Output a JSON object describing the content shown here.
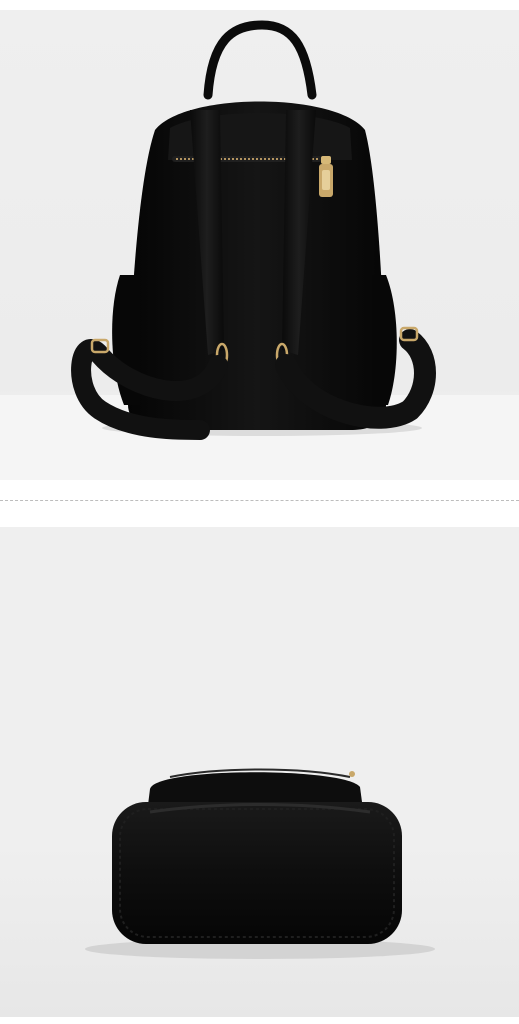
{
  "colors": {
    "panel_background": "#efefef",
    "floor_highlight": "#f7f7f7",
    "bag_black": "#0c0c0c",
    "hardware_gold": "#c9a86a",
    "divider": "#bdbdbd"
  },
  "images": [
    {
      "subject": "backpack-rear-view"
    },
    {
      "subject": "backpack-bottom-view"
    }
  ]
}
